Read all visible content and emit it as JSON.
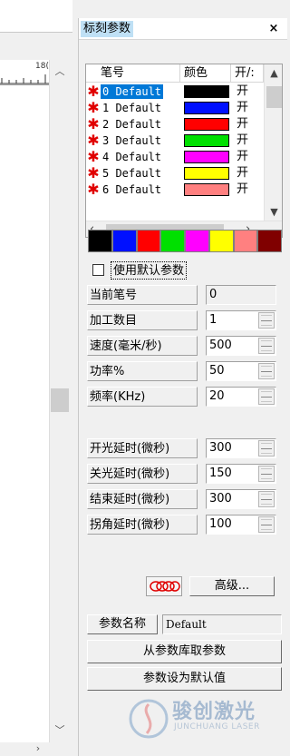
{
  "panel": {
    "title": "标刻参数",
    "close_icon": "×"
  },
  "ruler": {
    "label": "18("
  },
  "pen_list": {
    "headers": [
      "笔号",
      "颜色",
      "开/:"
    ],
    "rows": [
      {
        "name": "0 Default",
        "color": "#000000",
        "on": "开",
        "selected": true
      },
      {
        "name": "1 Default",
        "color": "#0010ff",
        "on": "开",
        "selected": false
      },
      {
        "name": "2 Default",
        "color": "#ff0000",
        "on": "开",
        "selected": false
      },
      {
        "name": "3 Default",
        "color": "#00e000",
        "on": "开",
        "selected": false
      },
      {
        "name": "4 Default",
        "color": "#ff00ff",
        "on": "开",
        "selected": false
      },
      {
        "name": "5 Default",
        "color": "#ffff00",
        "on": "开",
        "selected": false
      },
      {
        "name": "6 Default",
        "color": "#ff8080",
        "on": "开",
        "selected": false
      }
    ]
  },
  "palette": [
    "#000000",
    "#0010ff",
    "#ff0000",
    "#00e000",
    "#ff00ff",
    "#ffff00",
    "#ff8080",
    "#800000"
  ],
  "params": {
    "use_default_label": "使用默认参数",
    "current_pen_label": "当前笔号",
    "current_pen_value": "0",
    "fields": [
      {
        "label": "加工数目",
        "value": "1"
      },
      {
        "label": "速度(毫米/秒)",
        "value": "500"
      },
      {
        "label": "功率%",
        "value": "50"
      },
      {
        "label": "频率(KHz)",
        "value": "20"
      }
    ],
    "delays": [
      {
        "label": "开光延时(微秒)",
        "value": "300"
      },
      {
        "label": "关光延时(微秒)",
        "value": "150"
      },
      {
        "label": "结束延时(微秒)",
        "value": "300"
      },
      {
        "label": "拐角延时(微秒)",
        "value": "100"
      }
    ],
    "advanced_label": "高级..."
  },
  "param_name": {
    "label": "参数名称",
    "value": "Default"
  },
  "buttons": {
    "from_library": "从参数库取参数",
    "set_default": "参数设为默认值"
  },
  "watermark": {
    "cn": "骏创激光",
    "en": "JUNCHUANG LASER"
  }
}
